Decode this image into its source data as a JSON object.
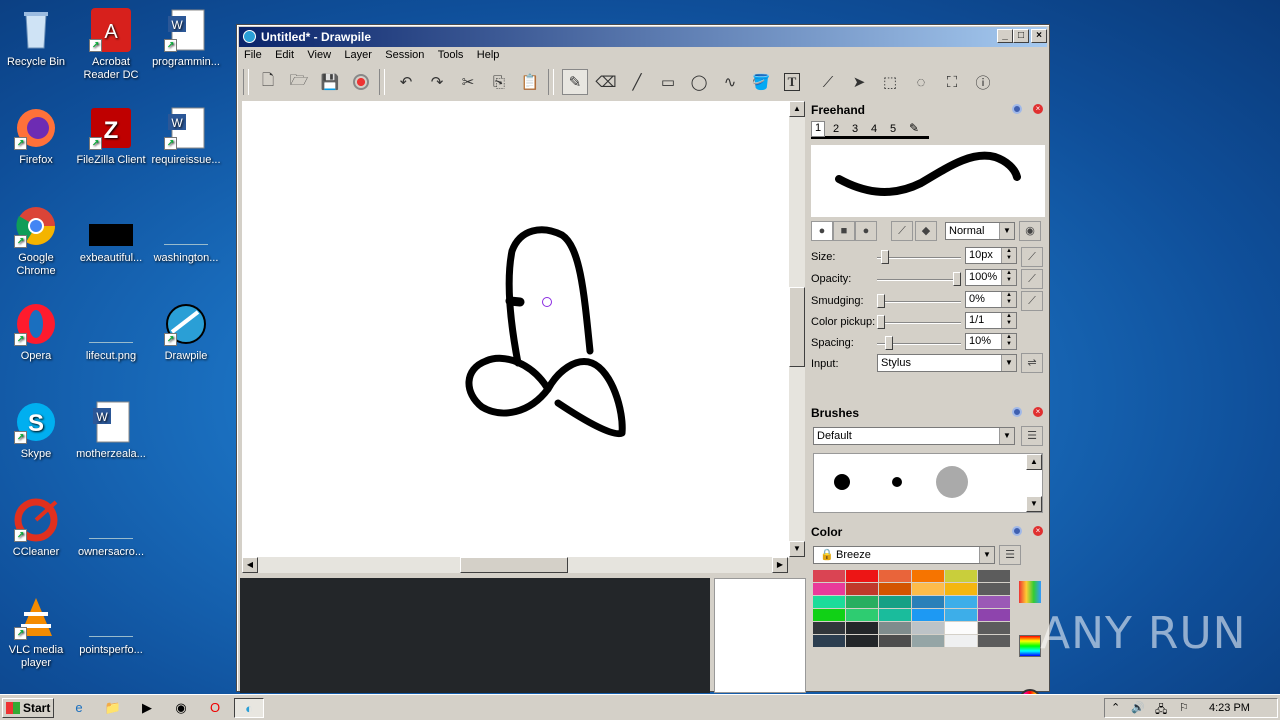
{
  "desktop": {
    "icons": [
      {
        "label": "Recycle Bin"
      },
      {
        "label": "Acrobat Reader DC"
      },
      {
        "label": "programmin..."
      },
      {
        "label": "Firefox"
      },
      {
        "label": "FileZilla Client"
      },
      {
        "label": "requireissue..."
      },
      {
        "label": "Google Chrome"
      },
      {
        "label": "exbeautiful..."
      },
      {
        "label": "washington..."
      },
      {
        "label": "Opera"
      },
      {
        "label": "lifecut.png"
      },
      {
        "label": "Drawpile"
      },
      {
        "label": "Skype"
      },
      {
        "label": "motherzeala..."
      },
      {
        "label": "CCleaner"
      },
      {
        "label": "ownersacro..."
      },
      {
        "label": "VLC media player"
      },
      {
        "label": "pointsperfo..."
      }
    ]
  },
  "window": {
    "title": "Untitled* - Drawpile",
    "menu": [
      "File",
      "Edit",
      "View",
      "Layer",
      "Session",
      "Tools",
      "Help"
    ]
  },
  "brush_panel": {
    "title": "Freehand",
    "slots": [
      "1",
      "2",
      "3",
      "4",
      "5"
    ],
    "blend_mode": "Normal",
    "size_label": "Size:",
    "size_value": "10px",
    "opacity_label": "Opacity:",
    "opacity_value": "100%",
    "smudging_label": "Smudging:",
    "smudging_value": "0%",
    "colorpickup_label": "Color pickup:",
    "colorpickup_value": "1/1",
    "spacing_label": "Spacing:",
    "spacing_value": "10%",
    "input_label": "Input:",
    "input_value": "Stylus",
    "levels": {
      "size": 0.05,
      "opacity": 1.0,
      "smudging": 0.0,
      "color_pickup": 0.0,
      "spacing": 0.1
    }
  },
  "brushes_panel": {
    "title": "Brushes",
    "preset": "Default"
  },
  "color_panel": {
    "title": "Color",
    "palette": "Breeze",
    "swatches": [
      [
        "#da4453",
        "#ed1515",
        "#e9643a",
        "#f67400",
        "#c9ce3b",
        "#5c5c5c"
      ],
      [
        "#e93a9a",
        "#c0392b",
        "#d35400",
        "#fdbc4b",
        "#f4b610",
        "#5c5c5c"
      ],
      [
        "#1cdc9a",
        "#27ae60",
        "#16a085",
        "#2980b9",
        "#3daee9",
        "#9b59b6"
      ],
      [
        "#11d116",
        "#2ecc71",
        "#1abc9c",
        "#1d99f3",
        "#3daee9",
        "#8e44ad"
      ],
      [
        "#31363b",
        "#232629",
        "#7f8c8d",
        "#bdc3c7",
        "#fcfcfc",
        "#5c5c5c"
      ],
      [
        "#2c3e50",
        "#232629",
        "#4d4d4d",
        "#95a5a6",
        "#eff0f1",
        "#5c5c5c"
      ]
    ]
  },
  "taskbar": {
    "start": "Start",
    "clock": "4:23 PM"
  },
  "watermark": "ANY RUN"
}
